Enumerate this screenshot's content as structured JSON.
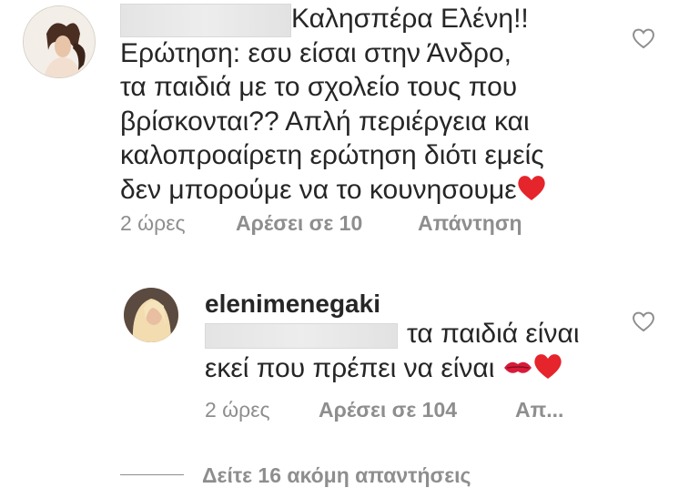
{
  "comment1": {
    "lines": [
      "Καλησπέρα Ελένη!!",
      "Ερώτηση: εσυ είσαι στην Άνδρο,",
      "τα παιδιά με το σχολείο τους που",
      "βρίσκονται?? Απλή περιέργεια και",
      "καλοπροαίρετη ερώτηση διότι εμείς",
      "δεν μπορούμε να το κουνησουμε"
    ],
    "time": "2 ώρες",
    "likes": "Αρέσει σε 10",
    "reply": "Απάντηση"
  },
  "comment2": {
    "username": "elenimenegaki",
    "line1": "τα παιδιά είναι",
    "line2": "εκεί που πρέπει να είναι",
    "time": "2 ώρες",
    "likes": "Αρέσει σε 104",
    "reply": "Απ..."
  },
  "view_replies": "Δείτε 16 ακόμη απαντήσεις",
  "colors": {
    "heart": "#ed4956",
    "secondary_text": "#8e8e8e",
    "primary_text": "#262626"
  },
  "icons": [
    "heart-outline-icon",
    "red-heart-emoji",
    "kiss-mark-emoji"
  ]
}
